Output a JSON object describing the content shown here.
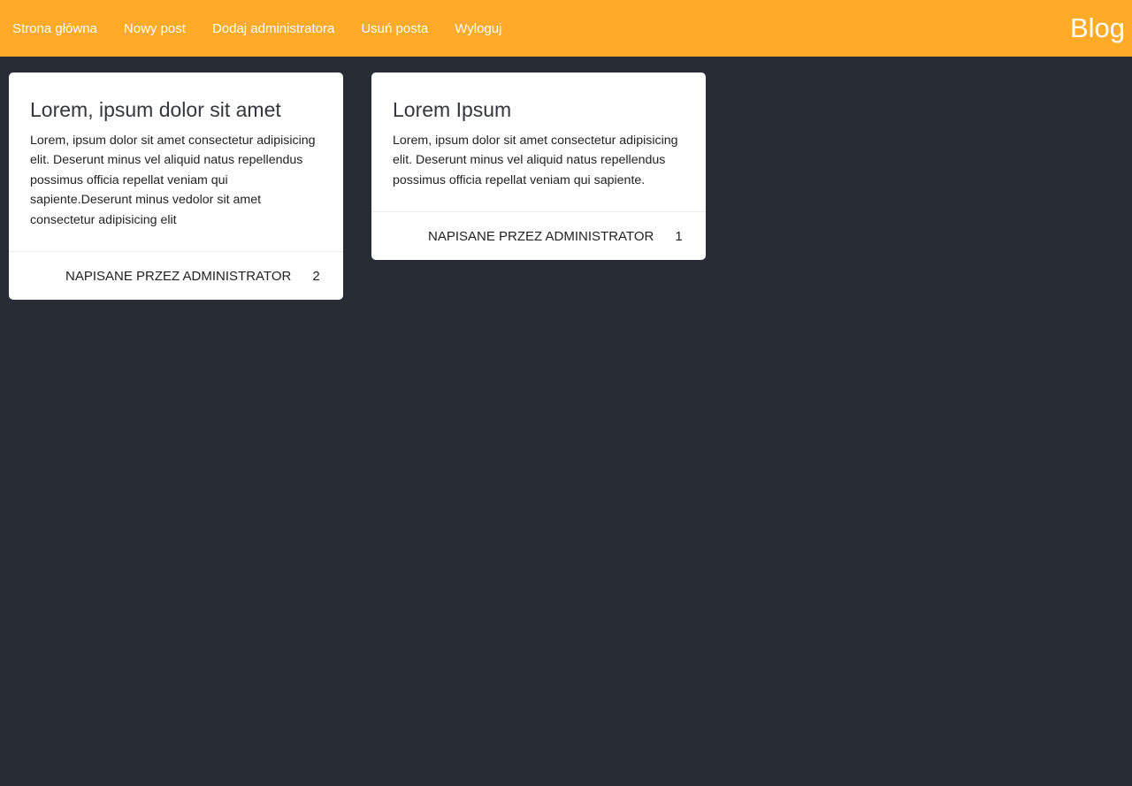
{
  "navbar": {
    "links": [
      {
        "label": "Strona główna"
      },
      {
        "label": "Nowy post"
      },
      {
        "label": "Dodaj administratora"
      },
      {
        "label": "Usuń posta"
      },
      {
        "label": "Wyloguj"
      }
    ],
    "brand": "Blog",
    "color": "#ffab27"
  },
  "page": {
    "background": "#282c35"
  },
  "posts": [
    {
      "title": "Lorem, ipsum dolor sit amet",
      "body": "Lorem, ipsum dolor sit amet consectetur adipisicing elit. Deserunt minus vel aliquid natus repellendus possimus officia repellat veniam qui sapiente.Deserunt minus vedolor sit amet consectetur adipisicing elit",
      "author": "NAPISANE PRZEZ ADMINISTRATOR",
      "number": "2"
    },
    {
      "title": "Lorem Ipsum",
      "body": "Lorem, ipsum dolor sit amet consectetur adipisicing elit. Deserunt minus vel aliquid natus repellendus possimus officia repellat veniam qui sapiente.",
      "author": "NAPISANE PRZEZ ADMINISTRATOR",
      "number": "1"
    }
  ]
}
